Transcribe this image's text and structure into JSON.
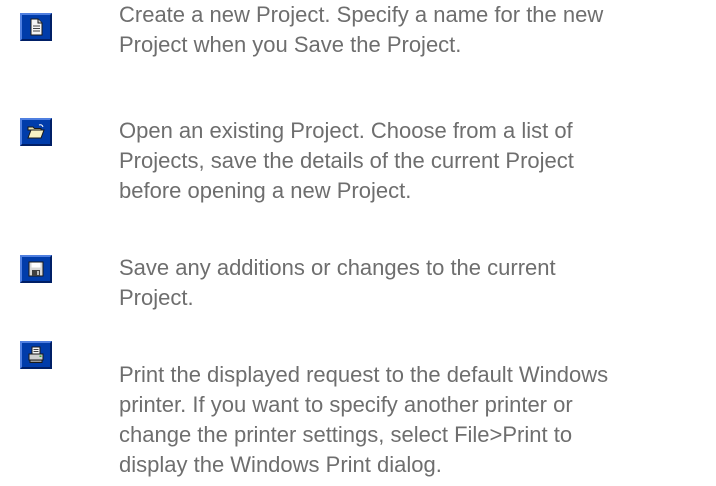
{
  "toolbar_help": {
    "items": [
      {
        "icon": "new-document-icon",
        "lines": [
          "Create a new Project. Specify a name for the new",
          "Project when you Save the Project."
        ]
      },
      {
        "icon": "open-folder-icon",
        "lines": [
          "Open an existing Project. Choose from a list of",
          "Projects, save the details of the current Project",
          "before opening a new Project."
        ]
      },
      {
        "icon": "save-disk-icon",
        "lines": [
          "Save any additions or changes to the current",
          "Project."
        ]
      },
      {
        "icon": "printer-icon",
        "lines": [
          "Print the displayed request to the default Windows",
          "printer. If you want to specify another printer or",
          "change the printer settings, select File>Print to",
          "display the Windows Print dialog."
        ]
      }
    ],
    "colors": {
      "text": "#6e6e6e",
      "icon_background": "#003caa"
    }
  }
}
